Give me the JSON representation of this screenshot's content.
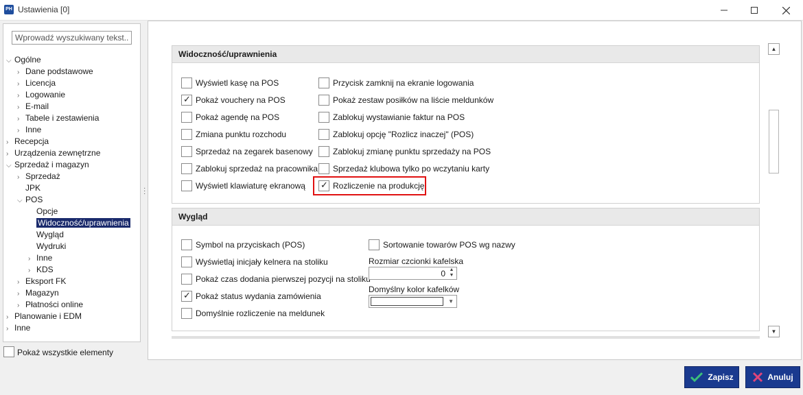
{
  "window": {
    "app_icon": "PH",
    "title": "Ustawienia [0]",
    "minimize_icon": "minimize-icon",
    "maximize_icon": "maximize-icon",
    "close_icon": "close-icon"
  },
  "search": {
    "placeholder": "Wprowadź wyszukiwany tekst..."
  },
  "tree": [
    {
      "label": "Ogólne",
      "level": 0,
      "state": "expanded"
    },
    {
      "label": "Dane podstawowe",
      "level": 1,
      "state": "collapsed"
    },
    {
      "label": "Licencja",
      "level": 1,
      "state": "collapsed"
    },
    {
      "label": "Logowanie",
      "level": 1,
      "state": "collapsed"
    },
    {
      "label": "E-mail",
      "level": 1,
      "state": "collapsed"
    },
    {
      "label": "Tabele i zestawienia",
      "level": 1,
      "state": "collapsed"
    },
    {
      "label": "Inne",
      "level": 1,
      "state": "collapsed"
    },
    {
      "label": "Recepcja",
      "level": 0,
      "state": "collapsed"
    },
    {
      "label": "Urządzenia zewnętrzne",
      "level": 0,
      "state": "collapsed"
    },
    {
      "label": "Sprzedaż i magazyn",
      "level": 0,
      "state": "expanded"
    },
    {
      "label": "Sprzedaż",
      "level": 1,
      "state": "collapsed"
    },
    {
      "label": "JPK",
      "level": 1,
      "state": "leaf"
    },
    {
      "label": "POS",
      "level": 1,
      "state": "expanded"
    },
    {
      "label": "Opcje",
      "level": 2,
      "state": "leaf"
    },
    {
      "label": "Widoczność/uprawnienia",
      "level": 2,
      "state": "leaf",
      "selected": true
    },
    {
      "label": "Wygląd",
      "level": 2,
      "state": "leaf"
    },
    {
      "label": "Wydruki",
      "level": 2,
      "state": "leaf"
    },
    {
      "label": "Inne",
      "level": 2,
      "state": "collapsed"
    },
    {
      "label": "KDS",
      "level": 2,
      "state": "collapsed"
    },
    {
      "label": "Eksport FK",
      "level": 1,
      "state": "collapsed"
    },
    {
      "label": "Magazyn",
      "level": 1,
      "state": "collapsed"
    },
    {
      "label": "Płatności online",
      "level": 1,
      "state": "collapsed"
    },
    {
      "label": "Planowanie i EDM",
      "level": 0,
      "state": "collapsed"
    },
    {
      "label": "Inne",
      "level": 0,
      "state": "collapsed"
    }
  ],
  "show_all": {
    "label": "Pokaż wszystkie elementy",
    "checked": false
  },
  "visibility": {
    "title": "Widoczność/uprawnienia",
    "left": [
      {
        "label": "Wyświetl kasę na POS",
        "checked": false
      },
      {
        "label": "Pokaż vouchery na POS",
        "checked": true
      },
      {
        "label": "Pokaż agendę na POS",
        "checked": false
      },
      {
        "label": "Zmiana punktu rozchodu",
        "checked": false
      },
      {
        "label": "Sprzedaż na zegarek basenowy",
        "checked": false
      },
      {
        "label": "Zablokuj sprzedaż na pracownika",
        "checked": false
      },
      {
        "label": "Wyświetl klawiaturę ekranową",
        "checked": false
      }
    ],
    "right": [
      {
        "label": "Przycisk zamknij na ekranie logowania",
        "checked": false
      },
      {
        "label": "Pokaż zestaw posiłków na liście meldunków",
        "checked": false
      },
      {
        "label": "Zablokuj wystawianie faktur na POS",
        "checked": false
      },
      {
        "label": "Zablokuj opcję \"Rozlicz inaczej\"  (POS)",
        "checked": false
      },
      {
        "label": "Zablokuj zmianę punktu sprzedaży na POS",
        "checked": false
      },
      {
        "label": "Sprzedaż klubowa tylko po wczytaniu karty",
        "checked": false
      },
      {
        "label": "Rozliczenie na produkcję",
        "checked": true,
        "highlighted": true
      }
    ]
  },
  "appearance": {
    "title": "Wygląd",
    "left": [
      {
        "label": "Symbol na przyciskach (POS)",
        "checked": false
      },
      {
        "label": "Wyświetlaj inicjały kelnera na stoliku",
        "checked": false
      },
      {
        "label": "Pokaż czas dodania pierwszej pozycji na stoliku",
        "checked": false
      },
      {
        "label": "Pokaż status wydania zamówienia",
        "checked": true
      },
      {
        "label": "Domyślnie rozliczenie na meldunek",
        "checked": false
      }
    ],
    "sort_option": {
      "label": "Sortowanie towarów POS wg nazwy",
      "checked": false
    },
    "font_size_label": "Rozmiar czcionki kafelska",
    "font_size_value": "0",
    "tile_color_label": "Domyślny kolor kafelków",
    "tile_color_value": "#ffffff"
  },
  "colors": {
    "accent": "#1a3a8f",
    "selection": "#1a2a6c",
    "highlight": "#e01010",
    "cancel_icon": "#e0457a",
    "save_icon": "#3cc07a"
  },
  "buttons": {
    "save": {
      "label": "Zapisz",
      "icon": "check-icon"
    },
    "cancel": {
      "label": "Anuluj",
      "icon": "x-icon"
    }
  }
}
